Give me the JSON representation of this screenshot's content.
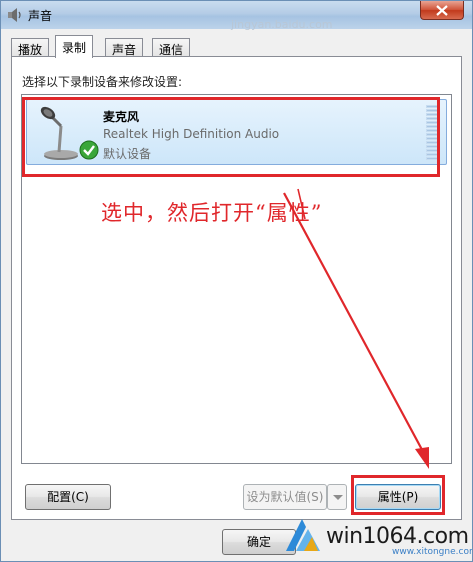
{
  "window": {
    "title": "声音",
    "faded_url": "jingyan.baidu.com"
  },
  "tabs": [
    {
      "label": "播放",
      "active": false
    },
    {
      "label": "录制",
      "active": true
    },
    {
      "label": "声音",
      "active": false
    },
    {
      "label": "通信",
      "active": false
    }
  ],
  "panel": {
    "instruction": "选择以下录制设备来修改设置:"
  },
  "device": {
    "name": "麦克风",
    "driver": "Realtek High Definition Audio",
    "status": "默认设备",
    "icon": "microphone-icon",
    "default_badge_icon": "check-badge-icon"
  },
  "annotation": {
    "text": "选中，然后打开“属性”",
    "color": "#e0272b"
  },
  "buttons": {
    "configure": "配置(C)",
    "set_default": "设为默认值(S)",
    "properties": "属性(P)",
    "ok": "确定"
  },
  "watermark": {
    "domain": "win1064.com",
    "sub": "www.xitongne.com"
  },
  "colors": {
    "accent": "#e0272b",
    "selection": "#cde6f9",
    "titlebar": "#b4cce6"
  }
}
